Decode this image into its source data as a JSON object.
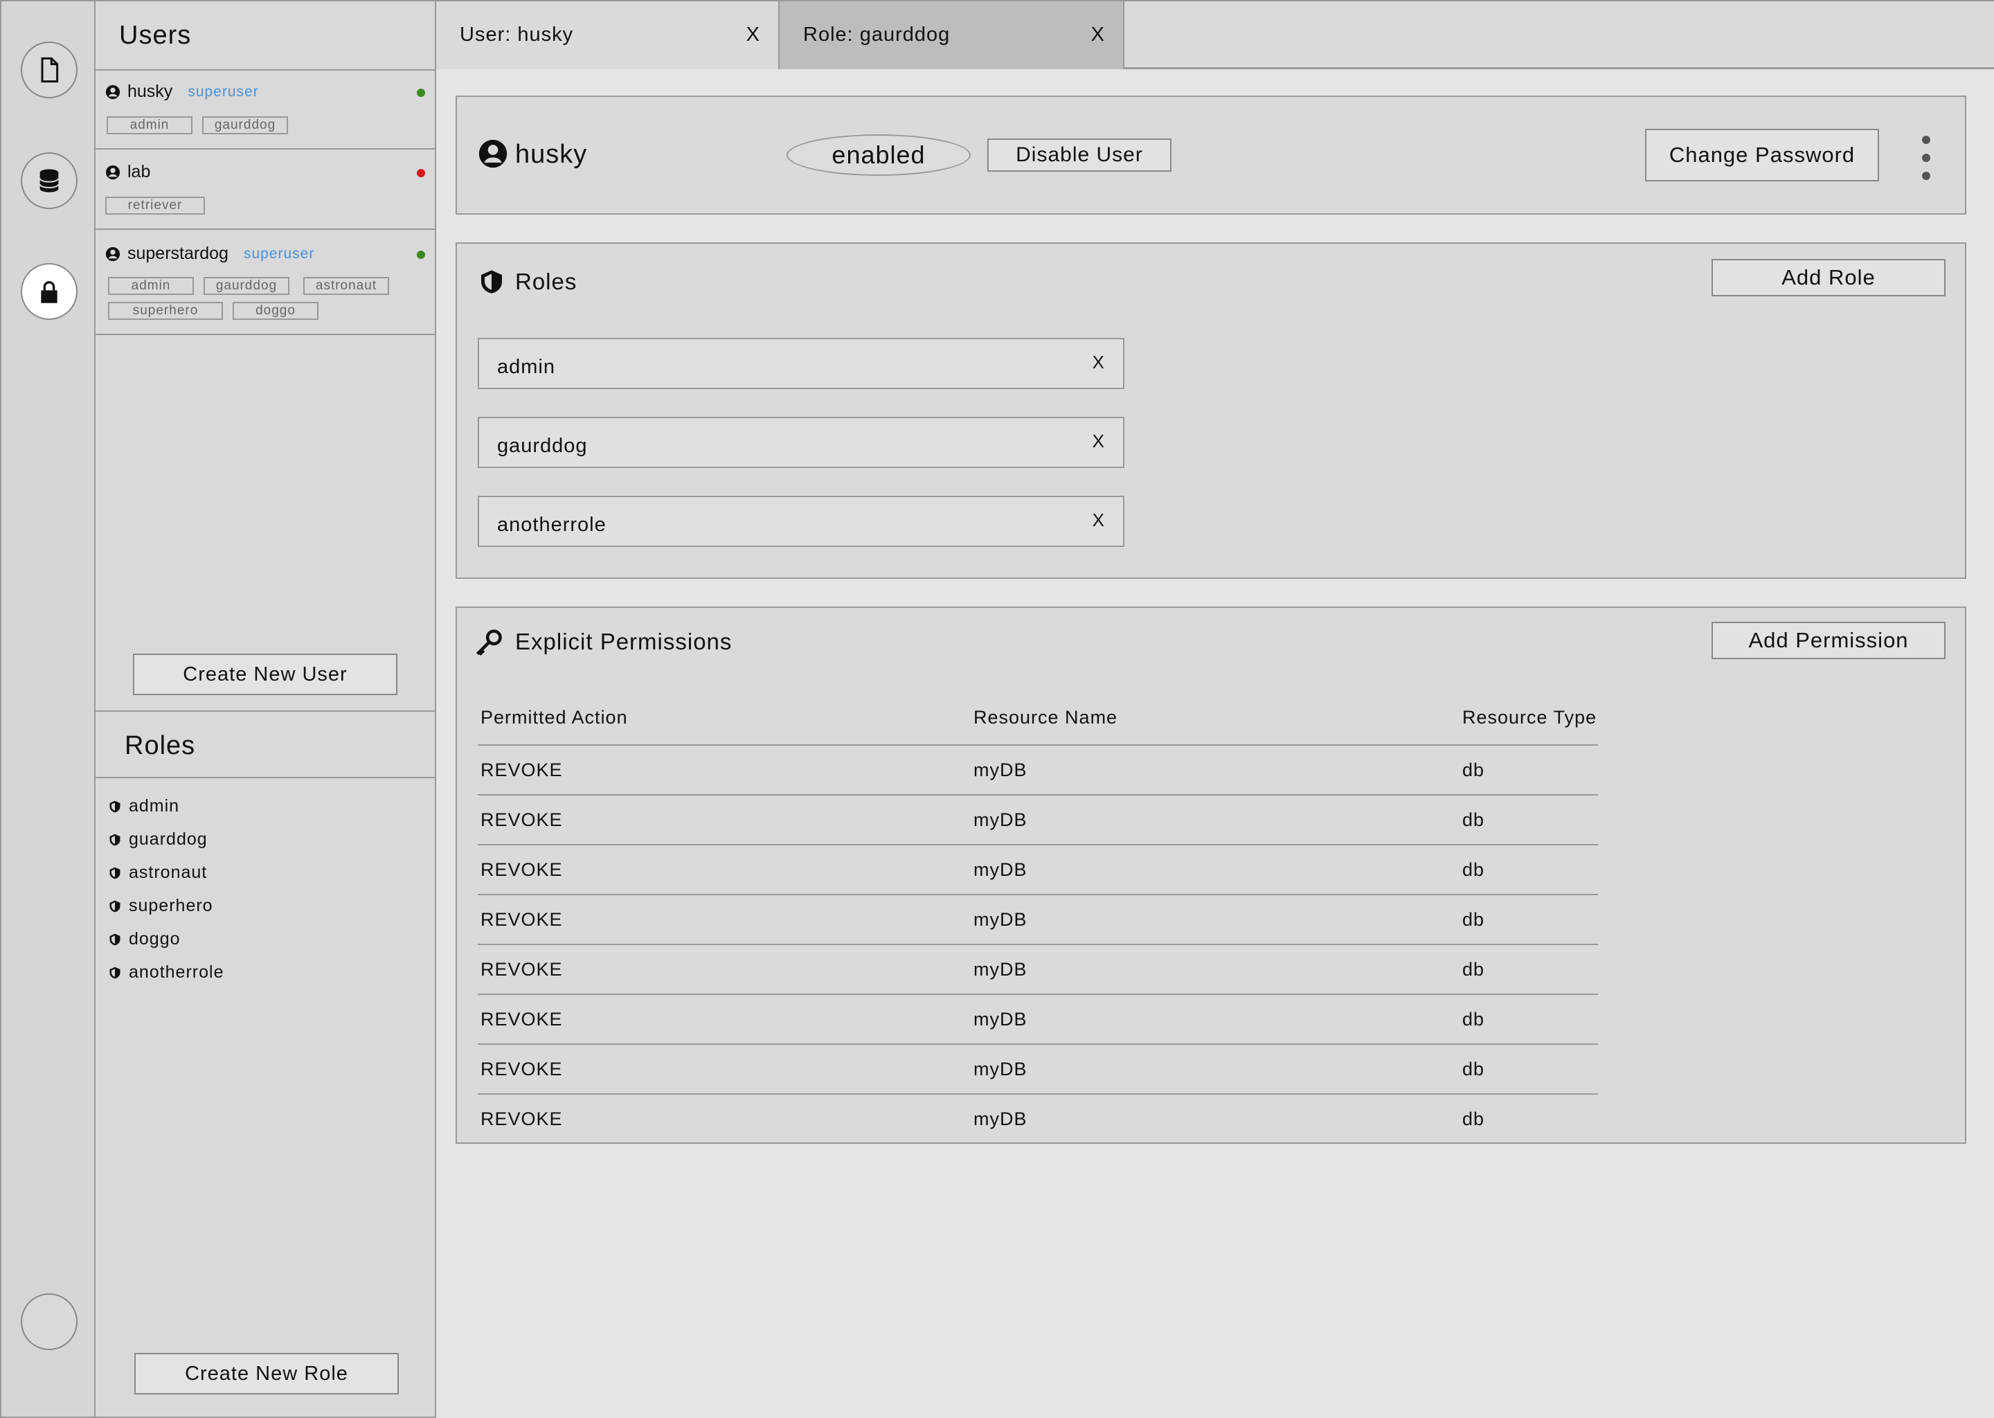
{
  "rail": {
    "items": [
      {
        "icon": "document-icon"
      },
      {
        "icon": "database-icon"
      },
      {
        "icon": "lock-icon",
        "active": true
      },
      {
        "icon": "avatar-placeholder"
      }
    ]
  },
  "sidebar": {
    "users_title": "Users",
    "users": [
      {
        "name": "husky",
        "badge": "superuser",
        "status": "active",
        "status_color": "#3a8a1e",
        "roles": [
          "admin",
          "gaurddog"
        ]
      },
      {
        "name": "lab",
        "badge": "",
        "status": "inactive",
        "status_color": "#d11a1a",
        "roles": [
          "retriever"
        ]
      },
      {
        "name": "superstardog",
        "badge": "superuser",
        "status": "active",
        "status_color": "#3a8a1e",
        "roles": [
          "admin",
          "gaurddog",
          "astronaut",
          "superhero",
          "doggo"
        ]
      }
    ],
    "create_user_label": "Create New User",
    "roles_title": "Roles",
    "roles": [
      "admin",
      "guarddog",
      "astronaut",
      "superhero",
      "doggo",
      "anotherrole"
    ],
    "create_role_label": "Create New Role"
  },
  "tabs": [
    {
      "label": "User: husky",
      "close": "X",
      "active": false
    },
    {
      "label": "Role: gaurddog",
      "close": "X",
      "active": true
    }
  ],
  "user_panel": {
    "name": "husky",
    "status": "enabled",
    "disable_label": "Disable User",
    "change_password_label": "Change Password"
  },
  "roles_panel": {
    "title": "Roles",
    "add_label": "Add Role",
    "roles": [
      "admin",
      "gaurddog",
      "anotherrole"
    ],
    "remove_label": "X"
  },
  "permissions_panel": {
    "title": "Explicit Permissions",
    "add_label": "Add Permission",
    "columns": [
      "Permitted Action",
      "Resource Name",
      "Resource Type"
    ],
    "rows": [
      [
        "REVOKE",
        "myDB",
        "db"
      ],
      [
        "REVOKE",
        "myDB",
        "db"
      ],
      [
        "REVOKE",
        "myDB",
        "db"
      ],
      [
        "REVOKE",
        "myDB",
        "db"
      ],
      [
        "REVOKE",
        "myDB",
        "db"
      ],
      [
        "REVOKE",
        "myDB",
        "db"
      ],
      [
        "REVOKE",
        "myDB",
        "db"
      ],
      [
        "REVOKE",
        "myDB",
        "db"
      ]
    ]
  },
  "colors": {
    "link_blue": "#4a90d9",
    "active_green": "#3a8a1e",
    "inactive_red": "#d11a1a",
    "panel_bg": "#dadada",
    "active_tab_bg": "#bdbdbd"
  }
}
